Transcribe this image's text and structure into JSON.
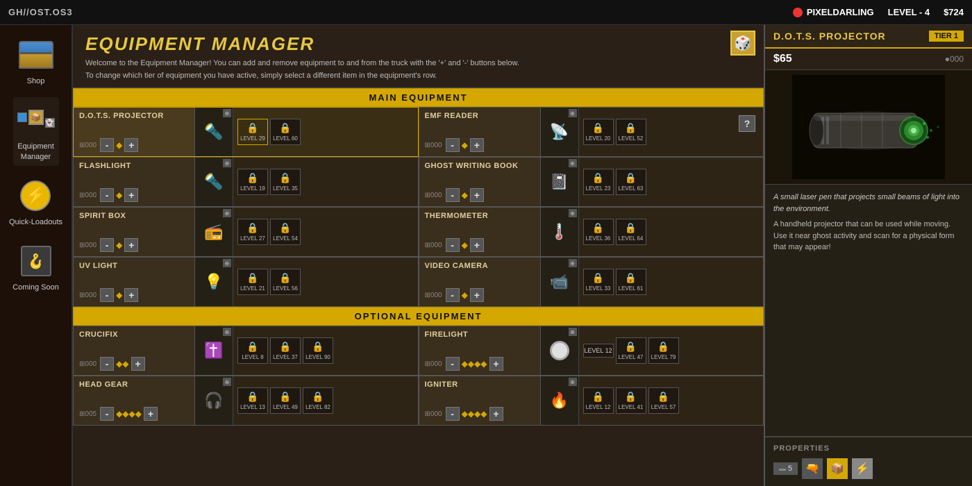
{
  "topbar": {
    "title": "GH//OST.OS3",
    "player_label": "PIXELDARLING",
    "level_label": "LEVEL - 4",
    "money": "$724"
  },
  "sidebar": {
    "items": [
      {
        "id": "shop",
        "label": "Shop",
        "icon": "🧰",
        "active": false
      },
      {
        "id": "equipment-manager",
        "label": "Equipment\nManager",
        "icon": "📦",
        "active": true
      },
      {
        "id": "quick-loadouts",
        "label": "Quick-Loadouts",
        "icon": "⚡",
        "active": false
      },
      {
        "id": "coming-soon",
        "label": "Coming Soon",
        "icon": "🪝",
        "active": false
      }
    ]
  },
  "header": {
    "title": "EQUIPMENT MANAGER",
    "subtitle_line1": "Welcome to the Equipment Manager! You can add and remove equipment to and from the truck with the '+' and '-' buttons below.",
    "subtitle_line2": "To change which tier of equipment you have active, simply select a different item in the equipment's row."
  },
  "main_section_label": "MAIN EQUIPMENT",
  "optional_section_label": "OPTIONAL EQUIPMENT",
  "main_equipment": [
    {
      "name": "D.O.T.S. PROJECTOR",
      "count": "000",
      "tiers": [
        {
          "level": "LEVEL 29",
          "locked": true
        },
        {
          "level": "LEVEL 60",
          "locked": true
        }
      ],
      "icon": "🔦",
      "selected": true
    },
    {
      "name": "EMF READER",
      "count": "000",
      "tiers": [
        {
          "level": "LEVEL 20",
          "locked": true
        },
        {
          "level": "LEVEL 52",
          "locked": true
        }
      ],
      "icon": "📡"
    },
    {
      "name": "FLASHLIGHT",
      "count": "000",
      "tiers": [
        {
          "level": "LEVEL 19",
          "locked": true
        },
        {
          "level": "LEVEL 35",
          "locked": true
        }
      ],
      "icon": "🔦"
    },
    {
      "name": "GHOST WRITING BOOK",
      "count": "000",
      "tiers": [
        {
          "level": "LEVEL 23",
          "locked": true
        },
        {
          "level": "LEVEL 63",
          "locked": true
        }
      ],
      "icon": "📓"
    },
    {
      "name": "SPIRIT BOX",
      "count": "000",
      "tiers": [
        {
          "level": "LEVEL 27",
          "locked": true
        },
        {
          "level": "LEVEL 54",
          "locked": true
        }
      ],
      "icon": "📻"
    },
    {
      "name": "THERMOMETER",
      "count": "000",
      "tiers": [
        {
          "level": "LEVEL 36",
          "locked": true
        },
        {
          "level": "LEVEL 64",
          "locked": true
        }
      ],
      "icon": "🌡️"
    },
    {
      "name": "UV LIGHT",
      "count": "000",
      "tiers": [
        {
          "level": "LEVEL 21",
          "locked": true
        },
        {
          "level": "LEVEL 56",
          "locked": true
        }
      ],
      "icon": "💡"
    },
    {
      "name": "VIDEO CAMERA",
      "count": "000",
      "tiers": [
        {
          "level": "LEVEL 33",
          "locked": true
        },
        {
          "level": "LEVEL 61",
          "locked": true
        }
      ],
      "icon": "📹"
    }
  ],
  "optional_equipment": [
    {
      "name": "CRUCIFIX",
      "count": "000",
      "tiers": [
        {
          "level": "LEVEL 8",
          "locked": true
        },
        {
          "level": "LEVEL 37",
          "locked": true
        },
        {
          "level": "LEVEL 90",
          "locked": true
        }
      ],
      "icon": "✝️"
    },
    {
      "name": "FIRELIGHT",
      "count": "000",
      "tiers": [
        {
          "level": "LEVEL 12",
          "locked": false,
          "circle": true
        },
        {
          "level": "LEVEL 47",
          "locked": true
        },
        {
          "level": "LEVEL 79",
          "locked": true
        }
      ],
      "icon": "🕯️"
    },
    {
      "name": "HEAD GEAR",
      "count": "005",
      "tiers": [
        {
          "level": "LEVEL 13",
          "locked": true
        },
        {
          "level": "LEVEL 49",
          "locked": true
        },
        {
          "level": "LEVEL 82",
          "locked": true
        }
      ],
      "icon": "🎧"
    },
    {
      "name": "IGNITER",
      "count": "000",
      "tiers": [
        {
          "level": "LEVEL 12",
          "locked": true
        },
        {
          "level": "LEVEL 41",
          "locked": true
        },
        {
          "level": "LEVEL 57",
          "locked": true
        }
      ],
      "icon": "🔥"
    }
  ],
  "detail_panel": {
    "item_name": "D.O.T.S. PROJECTOR",
    "tier": "TIER 1",
    "price": "$65",
    "stars": "●000",
    "desc_italic": "A small laser pen that projects small beams of light into the environment.",
    "desc_full": "A handheld projector that can be used while moving. Use it near ghost activity and scan for a physical form that may appear!",
    "properties_label": "PROPERTIES",
    "prop_count": "5",
    "prop_icons": [
      "🔫",
      "📦",
      "⚡"
    ]
  }
}
